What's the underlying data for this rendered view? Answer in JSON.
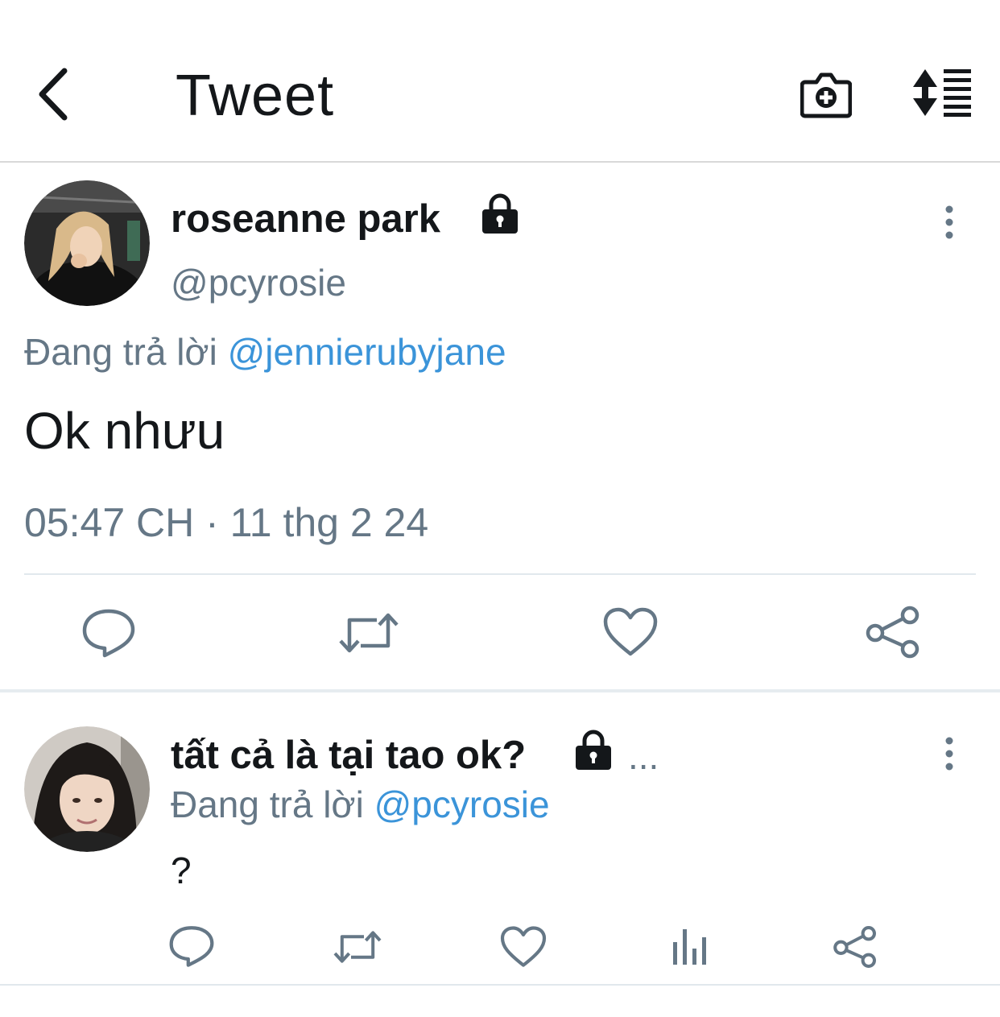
{
  "header": {
    "title": "Tweet"
  },
  "colors": {
    "accent": "#3b94d9",
    "muted": "#657786",
    "text": "#14171a"
  },
  "main_tweet": {
    "name": "roseanne park",
    "handle": "@pcyrosie",
    "replying_prefix": "Đang trả lời",
    "replying_to": "@jennierubyjane",
    "text": "Ok nhưu",
    "timestamp": "05:47 CH · 11 thg 2 24",
    "locked": true
  },
  "reply_tweet": {
    "name": "tất cả là tại tao ok?",
    "ellipsis": "...",
    "replying_prefix": "Đang trả lời",
    "replying_to": "@pcyrosie",
    "text": "?",
    "locked": true
  },
  "icons": {
    "back": "chevron-left-icon",
    "camera": "camera-plus-icon",
    "sort": "sort-list-icon",
    "more": "more-vertical-icon",
    "lock": "lock-icon",
    "reply": "reply-icon",
    "retweet": "retweet-icon",
    "like": "heart-icon",
    "analytics": "analytics-icon",
    "share": "share-icon"
  }
}
